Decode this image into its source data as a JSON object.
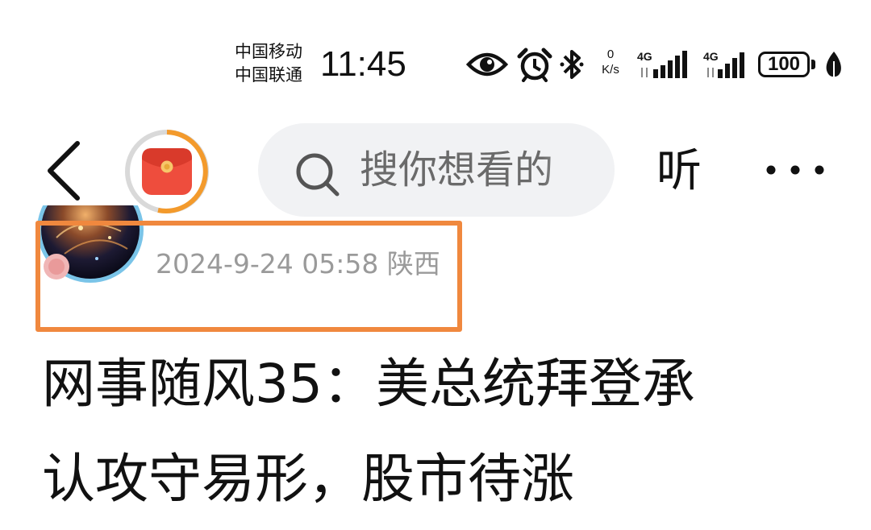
{
  "status_bar": {
    "carrier_1": "中国移动",
    "carrier_2": "中国联通",
    "time": "11:45",
    "net_speed_value": "0",
    "net_speed_unit": "K/s",
    "sim1_network": "4G",
    "sim2_network": "4G",
    "battery": "100",
    "icons": [
      "eye-icon",
      "alarm-icon",
      "bluetooth-icon",
      "signal-icon",
      "charging-leaf-icon"
    ]
  },
  "nav": {
    "back_icon": "chevron-left-icon",
    "red_packet_icon": "red-packet-icon",
    "search_icon": "search-icon",
    "search_placeholder": "搜你想看的",
    "listen_label": "听",
    "more_icon": "more-dots-icon"
  },
  "article": {
    "meta": "2024-9-24 05:58 陕西",
    "title_line_1": "网事随风35：美总统拜登承",
    "title_line_2": "认攻守易形，股市待涨"
  },
  "colors": {
    "highlight_border": "#f0883e",
    "red_packet": "#ee4d3d",
    "progress_ring": "#f39a2c",
    "search_bg": "#f1f2f4",
    "meta_text": "#9a9a9a"
  }
}
